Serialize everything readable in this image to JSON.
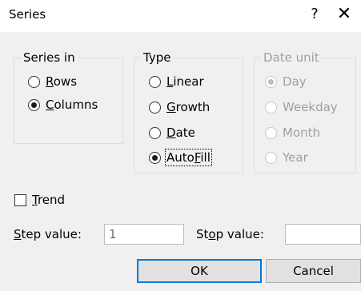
{
  "window": {
    "title": "Series",
    "help_label": "?",
    "close_label": "✕"
  },
  "series_in": {
    "legend": "Series in",
    "options": [
      {
        "label_pre": "",
        "label_u": "R",
        "label_post": "ows",
        "selected": false
      },
      {
        "label_pre": "",
        "label_u": "C",
        "label_post": "olumns",
        "selected": true
      }
    ]
  },
  "type": {
    "legend": "Type",
    "options": [
      {
        "label_pre": "",
        "label_u": "L",
        "label_post": "inear",
        "selected": false
      },
      {
        "label_pre": "",
        "label_u": "G",
        "label_post": "rowth",
        "selected": false
      },
      {
        "label_pre": "",
        "label_u": "D",
        "label_post": "ate",
        "selected": false
      },
      {
        "label_pre": "Auto",
        "label_u": "F",
        "label_post": "ill",
        "selected": true
      }
    ]
  },
  "date_unit": {
    "legend": "Date unit",
    "disabled": true,
    "options": [
      {
        "label": "Day",
        "selected": true
      },
      {
        "label": "Weekday",
        "selected": false
      },
      {
        "label": "Month",
        "selected": false
      },
      {
        "label": "Year",
        "selected": false
      }
    ]
  },
  "trend": {
    "label_pre": "",
    "label_u": "T",
    "label_post": "rend",
    "checked": false
  },
  "step": {
    "label_pre": "",
    "label_u": "S",
    "label_post": "tep value:",
    "value": "1"
  },
  "stop": {
    "label_pre": "St",
    "label_u": "o",
    "label_post": "p value:",
    "value": ""
  },
  "buttons": {
    "ok": "OK",
    "cancel": "Cancel"
  }
}
